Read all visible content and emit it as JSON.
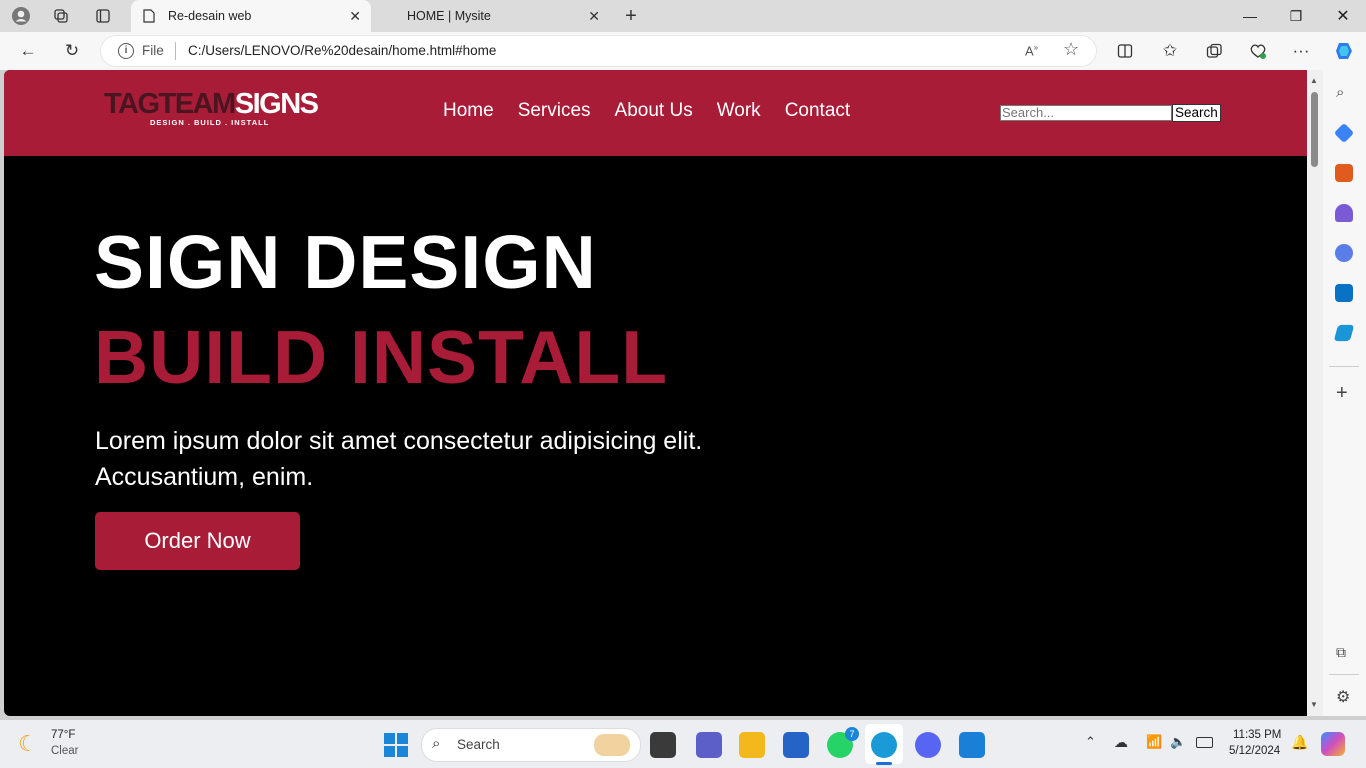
{
  "browser": {
    "tabs": [
      {
        "title": "Re-desain web",
        "active": true
      },
      {
        "title": "HOME | Mysite",
        "active": false
      }
    ],
    "address": {
      "scheme_label": "File",
      "url": "C:/Users/LENOVO/Re%20desain/home.html#home"
    }
  },
  "site": {
    "logo": {
      "main_part1": "TAGTEAM",
      "main_part2": "SIGNS",
      "tagline": "DESIGN . BUILD . INSTALL"
    },
    "nav": [
      "Home",
      "Services",
      "About Us",
      "Work",
      "Contact"
    ],
    "search": {
      "placeholder": "Search...",
      "button": "Search"
    },
    "hero": {
      "line1": "SIGN DESIGN",
      "line2": "BUILD INSTALL",
      "text": "Lorem ipsum dolor sit amet consectetur adipisicing elit. Accusantium, enim.",
      "cta": "Order Now"
    },
    "colors": {
      "brand": "#a81c38",
      "background": "#000000"
    }
  },
  "taskbar": {
    "weather": {
      "temp": "77°F",
      "condition": "Clear"
    },
    "search_placeholder": "Search",
    "whatsapp_badge": "7",
    "clock": {
      "time": "11:35 PM",
      "date": "5/12/2024"
    }
  }
}
